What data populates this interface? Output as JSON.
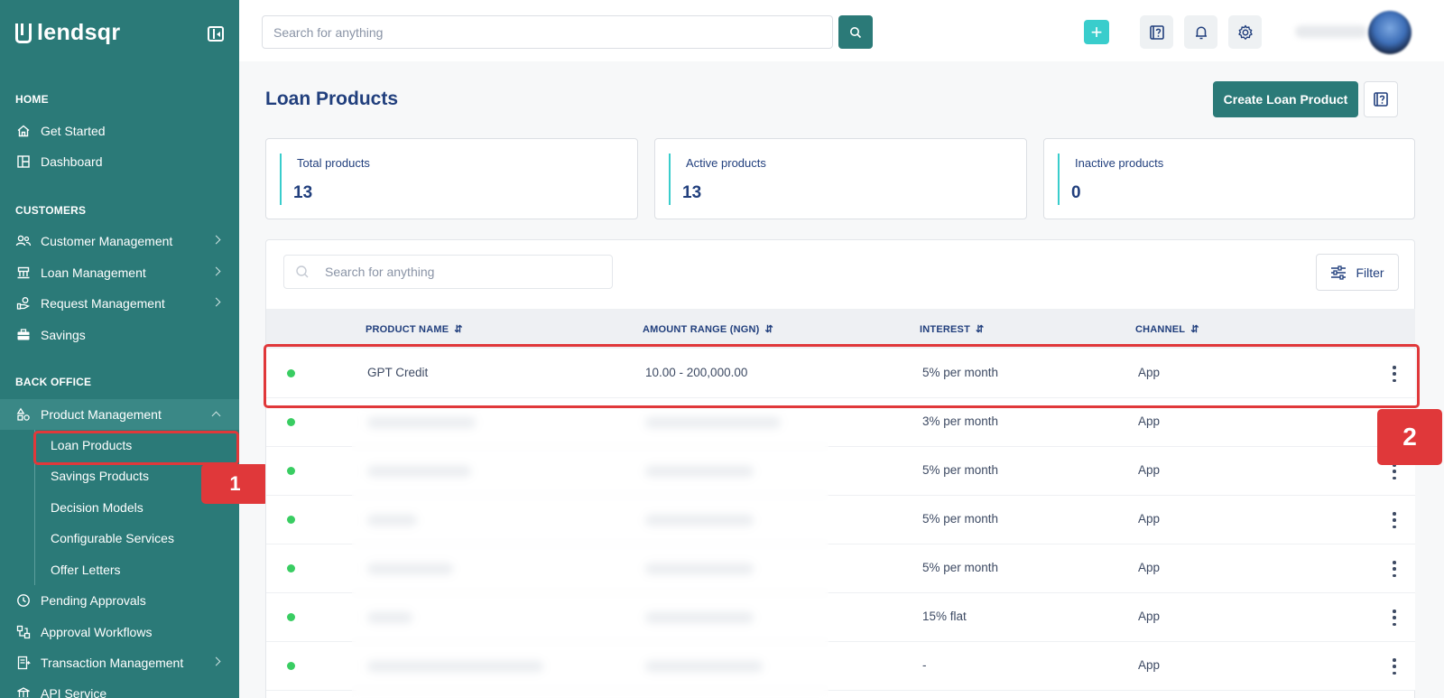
{
  "sidebar": {
    "logo_text": "lendsqr",
    "sections": {
      "home": "HOME",
      "customers": "CUSTOMERS",
      "back_office": "BACK OFFICE"
    },
    "items": {
      "get_started": "Get Started",
      "dashboard": "Dashboard",
      "customer_management": "Customer Management",
      "loan_management": "Loan Management",
      "request_management": "Request Management",
      "savings": "Savings",
      "product_management": "Product Management",
      "pending_approvals": "Pending Approvals",
      "approval_workflows": "Approval Workflows",
      "transaction_management": "Transaction Management",
      "api_service": "API Service"
    },
    "sub_items": {
      "loan_products": "Loan Products",
      "savings_products": "Savings Products",
      "decision_models": "Decision Models",
      "configurable_services": "Configurable Services",
      "offer_letters": "Offer Letters"
    }
  },
  "topbar": {
    "search_placeholder": "Search for anything"
  },
  "page": {
    "title": "Loan Products",
    "create_label": "Create Loan Product"
  },
  "stats": [
    {
      "label": "Total products",
      "value": "13"
    },
    {
      "label": "Active products",
      "value": "13"
    },
    {
      "label": "Inactive products",
      "value": "0"
    }
  ],
  "table": {
    "search_placeholder": "Search for anything",
    "filter_label": "Filter",
    "columns": [
      "PRODUCT NAME",
      "AMOUNT RANGE (NGN)",
      "INTEREST",
      "CHANNEL"
    ],
    "rows": [
      {
        "name": "GPT Credit",
        "amount": "10.00 - 200,000.00",
        "interest": "5% per month",
        "channel": "App"
      },
      {
        "name": "",
        "amount": "",
        "interest": "3% per month",
        "channel": "App"
      },
      {
        "name": "",
        "amount": "",
        "interest": "5% per month",
        "channel": "App"
      },
      {
        "name": "",
        "amount": "",
        "interest": "5% per month",
        "channel": "App"
      },
      {
        "name": "",
        "amount": "",
        "interest": "5% per month",
        "channel": "App"
      },
      {
        "name": "",
        "amount": "",
        "interest": "15% flat",
        "channel": "App"
      },
      {
        "name": "",
        "amount": "",
        "interest": "-",
        "channel": "App"
      }
    ]
  },
  "annotations": {
    "step1": "1",
    "step2": "2"
  },
  "colors": {
    "brand": "#2b7a78",
    "accent": "#39cdcc",
    "highlight": "#e0383a",
    "status_active": "#39cd62"
  }
}
